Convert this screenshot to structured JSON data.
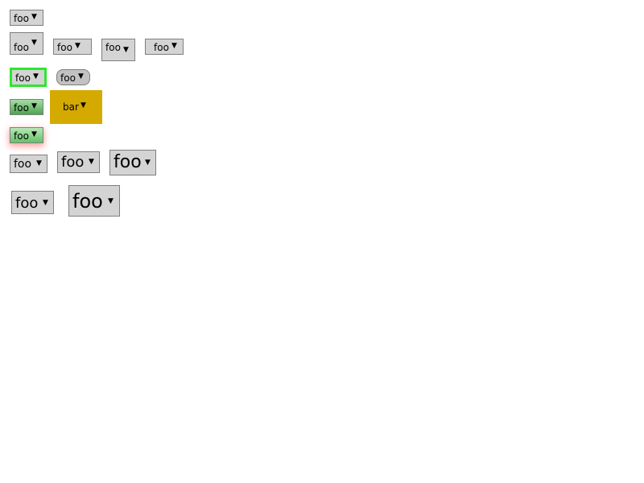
{
  "dropdowns": [
    {
      "id": "d1",
      "value": "foo",
      "arrow": "▼"
    },
    {
      "id": "d2",
      "value": "foo",
      "arrow": "▼"
    },
    {
      "id": "d3",
      "value": "foo",
      "arrow": "▼"
    },
    {
      "id": "d4",
      "value": "foo",
      "arrow": "▼"
    },
    {
      "id": "d5",
      "value": "foo",
      "arrow": "▼"
    },
    {
      "id": "d6",
      "value": "foo",
      "arrow": "▼",
      "border_color": "#2ee62e"
    },
    {
      "id": "d7",
      "value": "foo",
      "arrow": "▼"
    },
    {
      "id": "d8",
      "value": "foo",
      "arrow": "▼",
      "background": "green-gradient"
    },
    {
      "id": "d9",
      "value": "bar",
      "arrow": "▼",
      "background_color": "#d4aa00"
    },
    {
      "id": "d10",
      "value": "foo",
      "arrow": "▼",
      "background": "green-gradient",
      "shadow_color": "#ff5a5a"
    },
    {
      "id": "d11",
      "value": "foo",
      "arrow": "▼"
    },
    {
      "id": "d12",
      "value": "foo",
      "arrow": "▼"
    },
    {
      "id": "d13",
      "value": "foo",
      "arrow": "▼"
    },
    {
      "id": "d14",
      "value": "foo",
      "arrow": "▼"
    },
    {
      "id": "d15",
      "value": "foo",
      "arrow": "▼"
    }
  ]
}
